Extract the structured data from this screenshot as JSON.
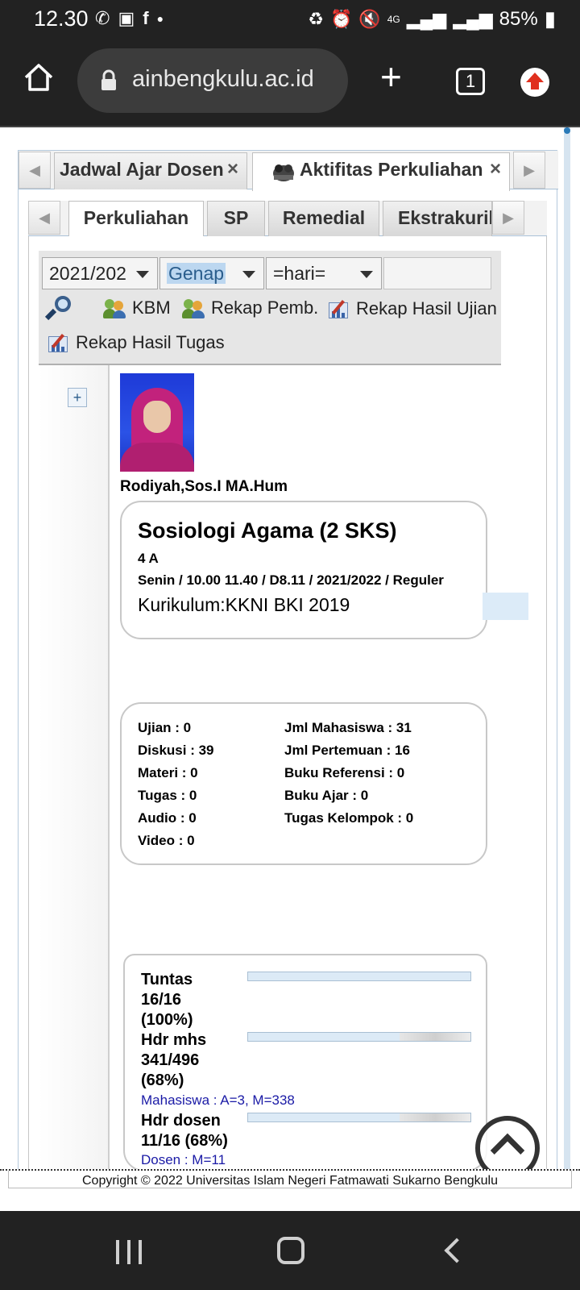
{
  "status_bar": {
    "time": "12.30",
    "network": "4G",
    "battery": "85%"
  },
  "browser": {
    "url": "ainbengkulu.ac.id",
    "tab_count": "1"
  },
  "main_tabs": [
    {
      "label": "Jadwal Ajar Dosen",
      "close": "×"
    },
    {
      "label": "Aktifitas Perkuliahan",
      "close": "×"
    }
  ],
  "sub_tabs": [
    {
      "label": "Perkuliahan"
    },
    {
      "label": "SP"
    },
    {
      "label": "Remedial"
    },
    {
      "label": "Ekstrakuril"
    }
  ],
  "filters": {
    "year": "2021/202",
    "semester": "Genap",
    "day": "=hari=",
    "search_value": ""
  },
  "actions": {
    "kbm": "KBM",
    "rekap_pemb": "Rekap Pemb.",
    "rekap_hasil_ujian": "Rekap Hasil Ujian",
    "rekap_hasil_tugas": "Rekap Hasil Tugas"
  },
  "expand_symbol": "+",
  "lecturer": {
    "name": "Rodiyah,Sos.I MA.Hum"
  },
  "course": {
    "title": "Sosiologi Agama (2 SKS)",
    "class": "4 A",
    "schedule": "Senin / 10.00 11.40 / D8.11 / 2021/2022 / Reguler",
    "curriculum": "Kurikulum:KKNI BKI 2019"
  },
  "stats": {
    "left": [
      "Ujian : 0",
      "Diskusi : 39",
      "Materi : 0",
      "Tugas : 0",
      "Audio : 0",
      "Video : 0"
    ],
    "right": [
      "Jml Mahasiswa : 31",
      "Jml Pertemuan : 16",
      "Buku Referensi : 0",
      "Buku Ajar : 0",
      "Tugas Kelompok : 0"
    ]
  },
  "progress": {
    "tuntas": {
      "line1": "Tuntas",
      "line2": "16/16",
      "line3": "(100%)",
      "percent": 100
    },
    "hdr_mhs": {
      "line1": "Hdr mhs",
      "line2": "341/496",
      "line3": "(68%)",
      "detail": "Mahasiswa : A=3, M=338",
      "percent": 68
    },
    "hdr_dosen": {
      "line1": "Hdr dosen",
      "line2": "11/16 (68%)",
      "detail": "Dosen : M=11",
      "percent": 68
    }
  },
  "footer": {
    "copyright": "Copyright © 2022 Universitas Islam Negeri Fatmawati Sukarno Bengkulu"
  },
  "icons": {
    "search": "magnifier-icon",
    "kbm": "users-icon",
    "rekap_pemb": "users-icon",
    "rekap_ujian": "chart-edit-icon",
    "rekap_tugas": "chart-edit-icon",
    "scroll_top": "chevron-up-icon"
  },
  "colors": {
    "detail_text": "#1a1aa6",
    "selection_highlight": "#bcd7f0",
    "update_badge": "#e0301e"
  }
}
